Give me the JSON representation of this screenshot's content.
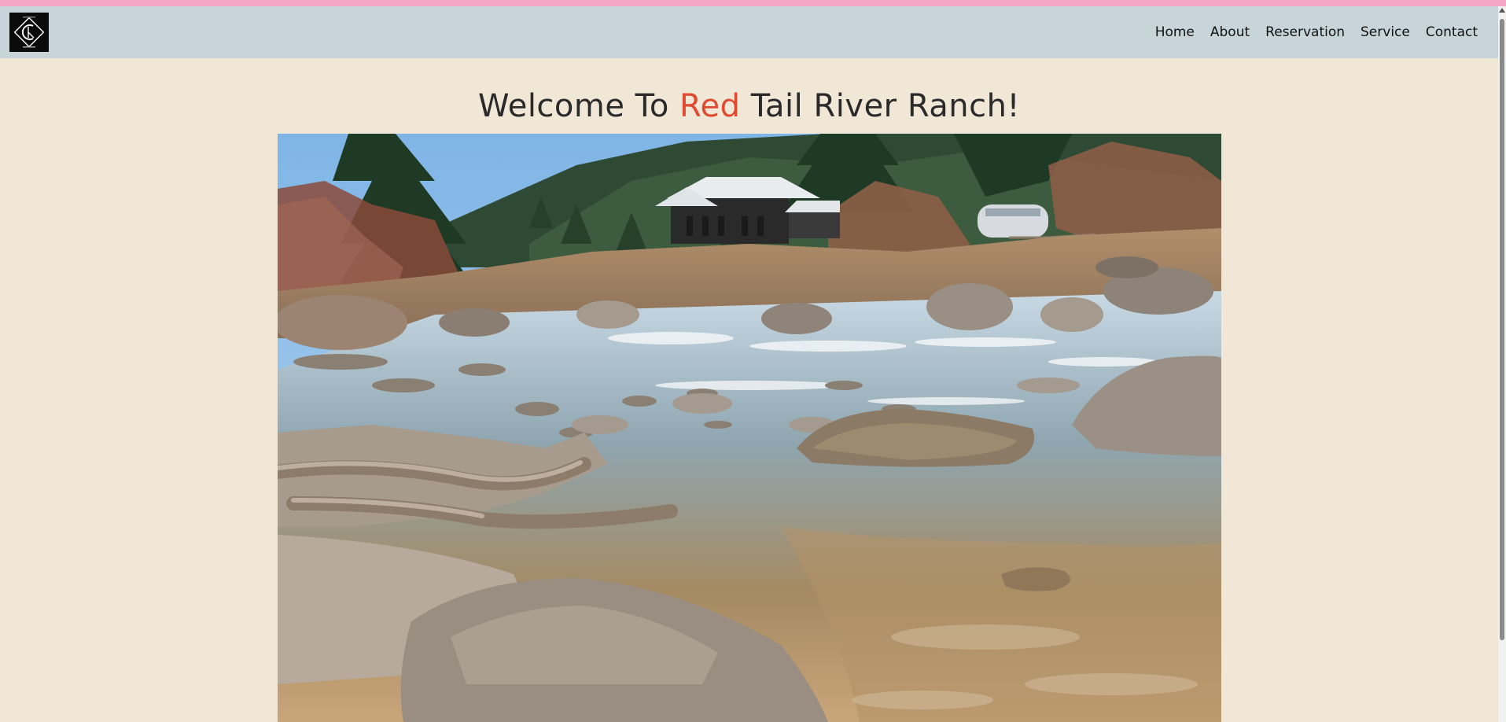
{
  "colors": {
    "top_strip": "#f5a3c7",
    "navbar_bg": "#c7d4d9",
    "page_bg": "#f1e7d7",
    "title_text": "#2a2a2a",
    "title_accent": "#e04a30"
  },
  "header": {
    "logo_icon": "ranch-logo-icon",
    "nav": [
      {
        "label": "Home"
      },
      {
        "label": "About"
      },
      {
        "label": "Reservation"
      },
      {
        "label": "Service"
      },
      {
        "label": "Contact"
      }
    ]
  },
  "hero": {
    "title_before": "Welcome To ",
    "title_accent": "Red",
    "title_after": " Tail River Ranch!",
    "image_icon": "river-ranch-photo"
  }
}
